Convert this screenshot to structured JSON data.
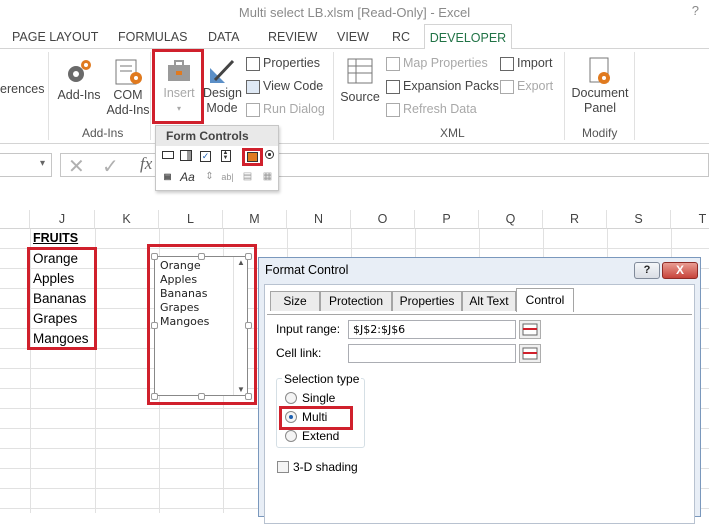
{
  "window": {
    "title": "Multi select LB.xlsm  [Read-Only] - Excel",
    "help": "?"
  },
  "tabs": [
    "PAGE LAYOUT",
    "FORMULAS",
    "DATA",
    "REVIEW",
    "VIEW",
    "RC",
    "DEVELOPER"
  ],
  "ribbon": {
    "left_cut": "erences",
    "addins": {
      "addins": "Add-Ins",
      "com1": "COM",
      "com2": "Add-Ins",
      "group": "Add-Ins"
    },
    "controls": {
      "insert": "Insert",
      "design1": "Design",
      "design2": "Mode",
      "properties": "Properties",
      "view_code": "View Code",
      "run_dialog": "Run Dialog"
    },
    "xml": {
      "source": "Source",
      "map_properties": "Map Properties",
      "expansion_packs": "Expansion Packs",
      "refresh_data": "Refresh Data",
      "import": "Import",
      "export": "Export",
      "group": "XML"
    },
    "modify": {
      "doc1": "Document",
      "doc2": "Panel",
      "group": "Modify"
    }
  },
  "form_controls": {
    "title": "Form Controls"
  },
  "formula_bar": {
    "fx": "fx"
  },
  "sheet": {
    "columns": [
      "J",
      "K",
      "L",
      "M",
      "N",
      "O",
      "P",
      "Q",
      "R",
      "S",
      "T"
    ],
    "header": "FRUITS",
    "fruits": [
      "Orange",
      "Apples",
      "Bananas",
      "Grapes",
      "Mangoes"
    ]
  },
  "listbox": {
    "items": [
      "Orange",
      "Apples",
      "Bananas",
      "Grapes",
      "Mangoes"
    ]
  },
  "dialog": {
    "title": "Format Control",
    "help": "?",
    "close": "X",
    "tabs": [
      "Size",
      "Protection",
      "Properties",
      "Alt Text",
      "Control"
    ],
    "input_range_label": "Input range:",
    "input_range_value": "$J$2:$J$6",
    "cell_link_label": "Cell link:",
    "cell_link_value": "",
    "selection_type_label": "Selection type",
    "options": [
      "Single",
      "Multi",
      "Extend"
    ],
    "selected_option": "Multi",
    "shading_label": "3-D shading"
  },
  "colors": {
    "accent": "#217346",
    "highlight": "#d0202c"
  }
}
